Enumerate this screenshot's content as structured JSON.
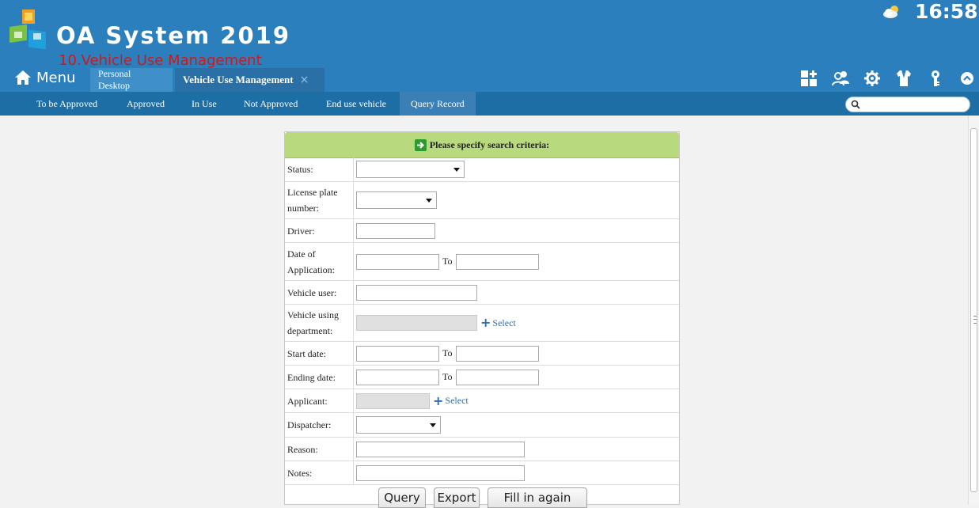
{
  "header": {
    "app_title": "OA System 2019",
    "overlay_caption": "10.Vehicle Use Management",
    "clock": "16:58",
    "weather_icon": "partly-cloudy-icon",
    "menu_label": "Menu"
  },
  "tabs": [
    {
      "label": "Personal Desktop"
    },
    {
      "label": "Vehicle Use Management",
      "close": "×"
    }
  ],
  "toolbar_icons": [
    "apps-add-icon",
    "users-icon",
    "gear-icon",
    "shirt-icon",
    "key-icon",
    "chevron-up-icon"
  ],
  "subnav": {
    "items": [
      {
        "label": "To be Approved"
      },
      {
        "label": "Approved"
      },
      {
        "label": "In Use"
      },
      {
        "label": "Not Approved"
      },
      {
        "label": "End use vehicle"
      },
      {
        "label": "Query Record"
      }
    ],
    "active": "Query Record",
    "search_value": ""
  },
  "form": {
    "header": "Please specify search criteria:",
    "labels": {
      "status": "Status:",
      "license_plate": "License plate number:",
      "driver": "Driver:",
      "date_of_application": "Date of Application:",
      "vehicle_user": "Vehicle user:",
      "vehicle_using_department": "Vehicle using department:",
      "start_date": "Start date:",
      "ending_date": "Ending date:",
      "applicant": "Applicant:",
      "dispatcher": "Dispatcher:",
      "reason": "Reason:",
      "notes": "Notes:"
    },
    "to_label": "To",
    "select_link": "Select",
    "values": {
      "status": "",
      "license_plate": "",
      "driver": "",
      "date_of_application_from": "",
      "date_of_application_to": "",
      "vehicle_user": "",
      "vehicle_using_department": "",
      "start_date_from": "",
      "start_date_to": "",
      "ending_date_from": "",
      "ending_date_to": "",
      "applicant": "",
      "dispatcher": "",
      "reason": "",
      "notes": ""
    },
    "buttons": {
      "query": "Query",
      "export": "Export",
      "fill_in_again": "Fill in again"
    }
  }
}
